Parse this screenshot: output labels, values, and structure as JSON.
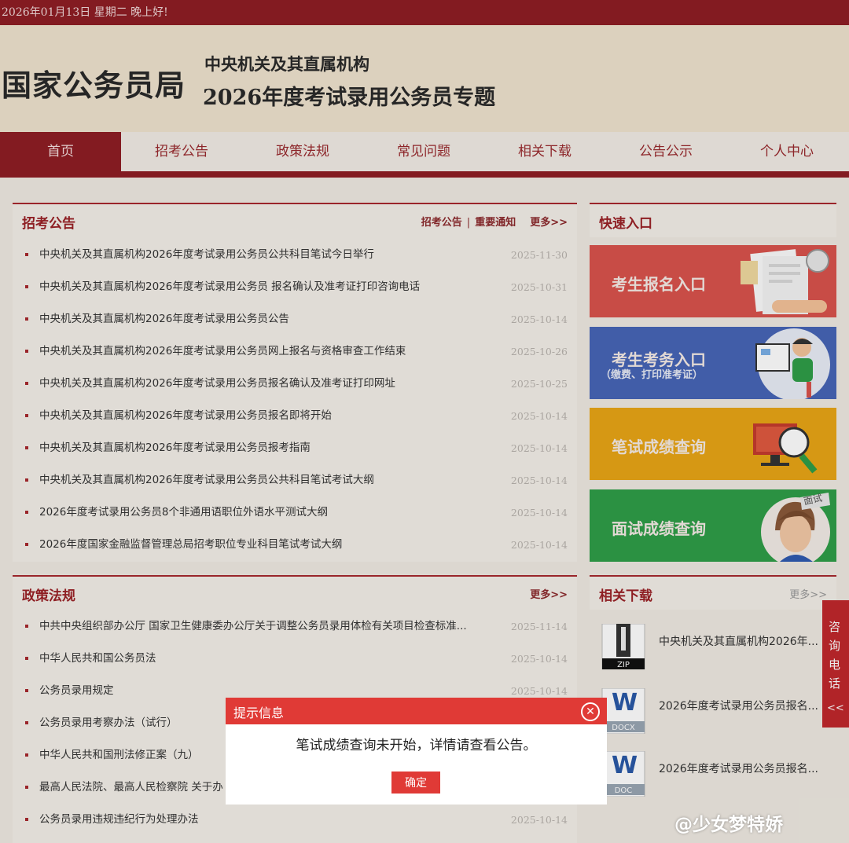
{
  "topbar": {
    "greeting": "2026年01月13日  星期二  晚上好!"
  },
  "header": {
    "logo": "国家公务员局",
    "subtitle1": "中央机关及其直属机构",
    "subtitle2": "2026年度考试录用公务员专题"
  },
  "nav": {
    "items": [
      "首页",
      "招考公告",
      "政策法规",
      "常见问题",
      "相关下载",
      "公告公示",
      "个人中心"
    ],
    "active": "首页"
  },
  "recruit": {
    "title": "招考公告",
    "link1": "招考公告",
    "link2": "重要通知",
    "more": "更多>>",
    "items": [
      {
        "title": "中央机关及其直属机构2026年度考试录用公务员公共科目笔试今日举行",
        "date": "2025-11-30"
      },
      {
        "title": "中央机关及其直属机构2026年度考试录用公务员 报名确认及准考证打印咨询电话",
        "date": "2025-10-31"
      },
      {
        "title": "中央机关及其直属机构2026年度考试录用公务员公告",
        "date": "2025-10-14"
      },
      {
        "title": "中央机关及其直属机构2026年度考试录用公务员网上报名与资格审查工作结束",
        "date": "2025-10-26"
      },
      {
        "title": "中央机关及其直属机构2026年度考试录用公务员报名确认及准考证打印网址",
        "date": "2025-10-25"
      },
      {
        "title": "中央机关及其直属机构2026年度考试录用公务员报名即将开始",
        "date": "2025-10-14"
      },
      {
        "title": "中央机关及其直属机构2026年度考试录用公务员报考指南",
        "date": "2025-10-14"
      },
      {
        "title": "中央机关及其直属机构2026年度考试录用公务员公共科目笔试考试大纲",
        "date": "2025-10-14"
      },
      {
        "title": "2026年度考试录用公务员8个非通用语职位外语水平测试大纲",
        "date": "2025-10-14"
      },
      {
        "title": "2026年度国家金融监督管理总局招考职位专业科目笔试考试大纲",
        "date": "2025-10-14"
      }
    ]
  },
  "policy": {
    "title": "政策法规",
    "more": "更多>>",
    "items": [
      {
        "title": "中共中央组织部办公厅 国家卫生健康委办公厅关于调整公务员录用体检有关项目检查标准...",
        "date": "2025-11-14"
      },
      {
        "title": "中华人民共和国公务员法",
        "date": "2025-10-14"
      },
      {
        "title": "公务员录用规定",
        "date": "2025-10-14"
      },
      {
        "title": "公务员录用考察办法（试行）",
        "date": ""
      },
      {
        "title": "中华人民共和国刑法修正案（九）",
        "date": ""
      },
      {
        "title": "最高人民法院、最高人民检察院 关于办",
        "date": ""
      },
      {
        "title": "公务员录用违规违纪行为处理办法",
        "date": "2025-10-14"
      }
    ]
  },
  "quick": {
    "title": "快速入口",
    "entries": [
      {
        "label": "考生报名入口",
        "color": "#d9534d"
      },
      {
        "label": "考生考务入口",
        "sub": "（缴费、打印准考证）",
        "color": "#4765b7"
      },
      {
        "label": "笔试成绩查询",
        "color": "#e9a516"
      },
      {
        "label": "面试成绩查询",
        "color": "#2f9e48",
        "badge": "面试"
      }
    ]
  },
  "downloads": {
    "title": "相关下载",
    "more": "更多>>",
    "items": [
      {
        "name": "中央机关及其直属机构2026年...",
        "type": "ZIP"
      },
      {
        "name": "2026年度考试录用公务员报名...",
        "type": "DOCX"
      },
      {
        "name": "2026年度考试录用公务员报名...",
        "type": "DOC"
      }
    ]
  },
  "consult": {
    "label": "咨询电话",
    "arrow": "<<"
  },
  "modal": {
    "title": "提示信息",
    "message": "笔试成绩查询未开始，详情请查看公告。",
    "button": "确定"
  },
  "watermark": "@少女梦特娇"
}
